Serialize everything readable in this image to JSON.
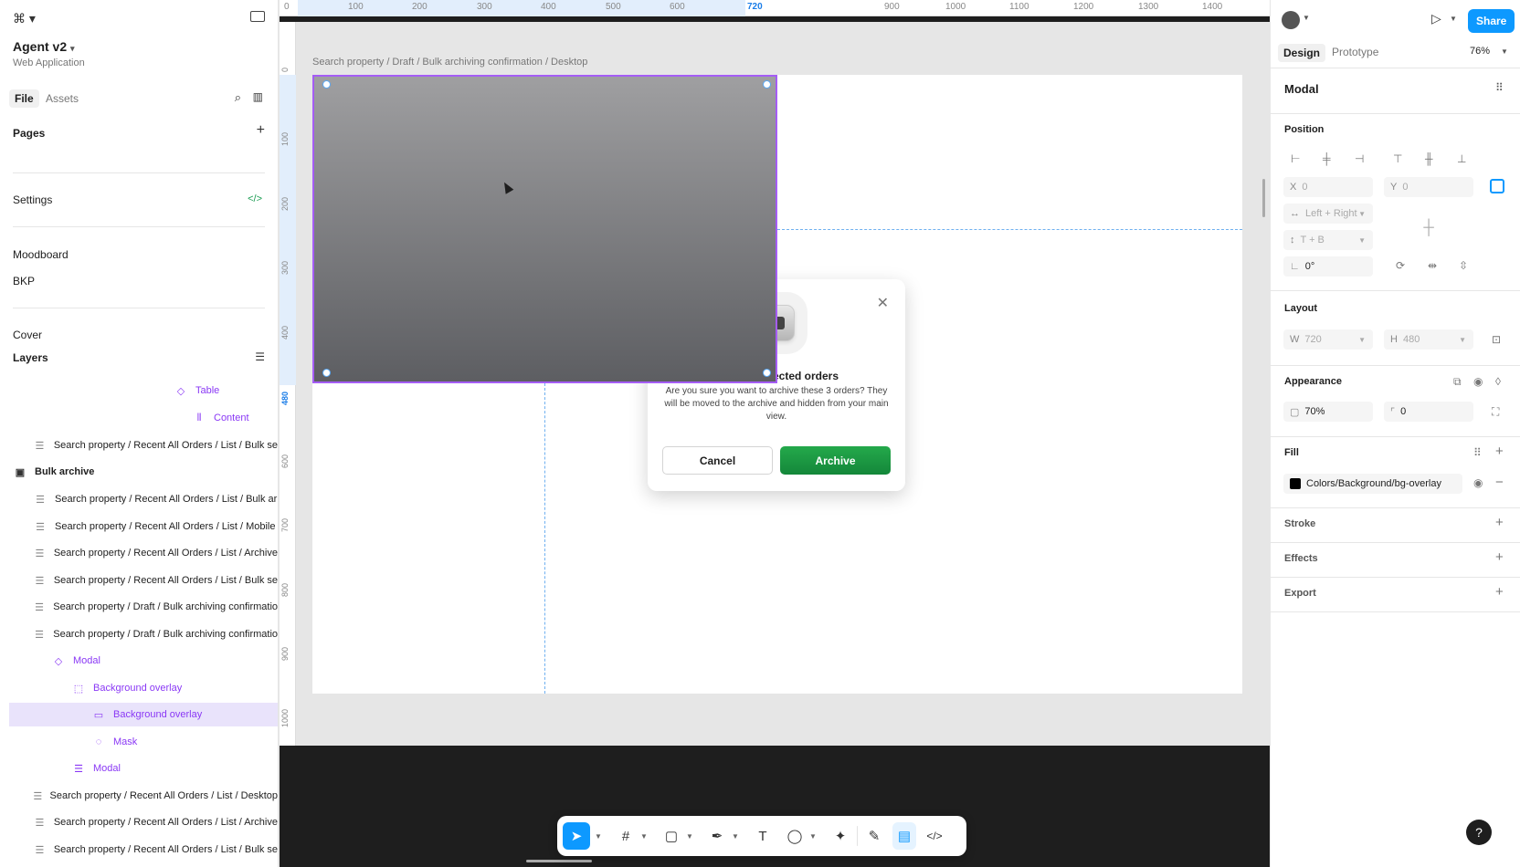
{
  "left_panel": {
    "project_name": "Agent v2",
    "project_sub": "Web Application",
    "tabs": {
      "file": "File",
      "assets": "Assets"
    },
    "pages_title": "Pages",
    "pages": [
      "Settings",
      "Moodboard",
      "BKP",
      "Cover"
    ],
    "layers_title": "Layers",
    "layers": [
      {
        "label": "Table",
        "icon": "component-icon"
      },
      {
        "label": "Content",
        "icon": "autolayout-icon"
      },
      {
        "label": "Search property / Recent All Orders / List / Bulk se",
        "icon": "frame-icon"
      },
      {
        "label": "Bulk archive",
        "icon": "section-icon"
      },
      {
        "label": "Search property / Recent All Orders / List / Bulk ar",
        "icon": "frame-icon"
      },
      {
        "label": "Search property / Recent All Orders / List / Mobile",
        "icon": "frame-icon"
      },
      {
        "label": "Search property / Recent All Orders / List / Archive",
        "icon": "frame-icon"
      },
      {
        "label": "Search property / Recent All Orders / List / Bulk se",
        "icon": "frame-icon"
      },
      {
        "label": "Search property / Draft / Bulk archiving confirmatio",
        "icon": "frame-icon"
      },
      {
        "label": "Search property / Draft / Bulk archiving confirmatio",
        "icon": "frame-icon"
      },
      {
        "label": "Modal",
        "icon": "component-icon"
      },
      {
        "label": "Background overlay",
        "icon": "mask-group-icon"
      },
      {
        "label": "Background overlay",
        "icon": "rectangle-icon"
      },
      {
        "label": "Mask",
        "icon": "mask-icon"
      },
      {
        "label": "Modal",
        "icon": "frame-icon"
      },
      {
        "label": "Search property / Recent All Orders / List / Desktop",
        "icon": "frame-icon"
      },
      {
        "label": "Search property / Recent All Orders / List / Archive",
        "icon": "frame-icon"
      },
      {
        "label": "Search property / Recent All Orders / List / Bulk se",
        "icon": "frame-icon"
      }
    ]
  },
  "canvas": {
    "ruler_top": [
      "0",
      "100",
      "200",
      "300",
      "400",
      "500",
      "600",
      "720",
      "900",
      "1000",
      "1100",
      "1200",
      "1300",
      "1400"
    ],
    "ruler_left": [
      "0",
      "100",
      "200",
      "300",
      "400",
      "480",
      "600",
      "700",
      "800",
      "900",
      "1000",
      "1100",
      "1200"
    ],
    "frame_label": "Search property / Draft / Bulk archiving confirmation / Desktop",
    "modal": {
      "title": "Archive selected orders",
      "body": "Are you sure you want to archive these 3 orders? They will be moved to the archive and hidden from your main view.",
      "cancel": "Cancel",
      "archive": "Archive"
    },
    "toolbar": [
      "move-icon",
      "frame-icon",
      "rectangle-icon",
      "pen-icon",
      "text-icon",
      "comment-icon",
      "actions-icon",
      "draw-icon",
      "dev-mode-icon",
      "code-icon"
    ]
  },
  "right_panel": {
    "share": "Share",
    "tabs": {
      "design": "Design",
      "prototype": "Prototype"
    },
    "zoom": "76%",
    "selection_name": "Modal",
    "position": {
      "title": "Position",
      "x_label": "X",
      "x": "0",
      "y_label": "Y",
      "y": "0",
      "h_constraint": "Left + Right",
      "v_constraint": "T + B",
      "rotation": "0°"
    },
    "layout": {
      "title": "Layout",
      "w_label": "W",
      "w": "720",
      "h_label": "H",
      "h": "480"
    },
    "appearance": {
      "title": "Appearance",
      "opacity": "70%",
      "radius": "0"
    },
    "fill": {
      "title": "Fill",
      "name": "Colors/Background/bg-overlay",
      "color": "#000000"
    },
    "stroke": "Stroke",
    "effects": "Effects",
    "export": "Export",
    "help": "?"
  },
  "colors": {
    "accent": "#0d99ff",
    "selection": "#a55df5",
    "archive_button": "#1a9a44"
  }
}
